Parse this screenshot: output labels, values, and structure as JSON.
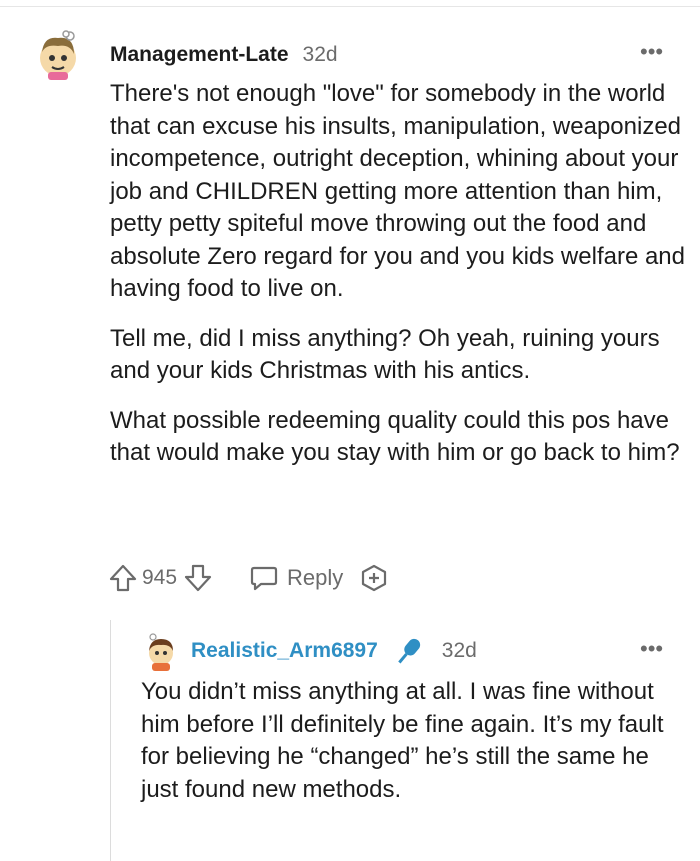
{
  "parent_comment": {
    "author": "Management-Late",
    "time": "32d",
    "paragraphs": [
      "There's not enough \"love\" for somebody in the world that can excuse his insults, manipulation, weaponized incompetence, outright deception, whining about your job and CHILDREN getting more attention than him, petty petty spiteful move throwing out the food and absolute Zero regard for you and you kids welfare and having food to live on.",
      "Tell me, did I miss anything? Oh yeah, ruining yours and your kids Christmas with his antics.",
      "What possible redeeming quality could this pos have that would make you stay with him or go back to him?"
    ],
    "score": "945",
    "reply_label": "Reply",
    "more_label": "•••"
  },
  "child_comment": {
    "author": "Realistic_Arm6897",
    "time": "32d",
    "paragraphs": [
      "You didn’t miss anything at all. I was fine without him before I’ll definitely be fine again. It’s my fault for believing he “changed” he’s still the same he just found new methods."
    ],
    "more_label": "•••"
  },
  "colors": {
    "text": "#1c1c1c",
    "meta": "#6b6b6b",
    "username_link": "#2f8fc4",
    "mic_icon": "#2f8fc4"
  },
  "icons": [
    "upvote-icon",
    "downvote-icon",
    "reply-icon",
    "award-icon",
    "more-icon",
    "microphone-icon"
  ]
}
